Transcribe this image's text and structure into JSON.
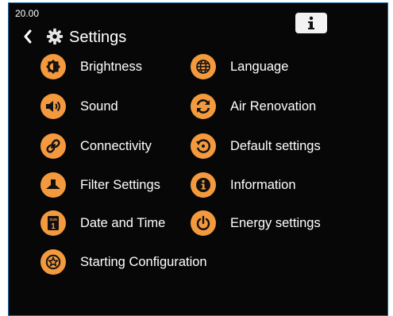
{
  "status": {
    "time": "20.00"
  },
  "header": {
    "title": "Settings",
    "back_icon": "chevron-left-icon",
    "title_icon": "gear-icon",
    "info_icon": "info-icon"
  },
  "colors": {
    "background": "#070707",
    "accent": "#f39a3e",
    "text": "#ffffff",
    "border": "#1a6fa8"
  },
  "menu": {
    "left": [
      {
        "label": "Brightness",
        "icon": "brightness-icon"
      },
      {
        "label": "Sound",
        "icon": "speaker-icon"
      },
      {
        "label": "Connectivity",
        "icon": "link-icon"
      },
      {
        "label": "Filter Settings",
        "icon": "hood-icon"
      },
      {
        "label": "Date and Time",
        "icon": "calendar-icon",
        "icon_text_top": "SUN",
        "icon_text_bottom": "1"
      },
      {
        "label": "Starting Configuration",
        "icon": "star-icon"
      }
    ],
    "right": [
      {
        "label": "Language",
        "icon": "globe-icon"
      },
      {
        "label": "Air Renovation",
        "icon": "refresh-icon"
      },
      {
        "label": "Default settings",
        "icon": "restore-icon"
      },
      {
        "label": "Information",
        "icon": "info-icon"
      },
      {
        "label": "Energy settings",
        "icon": "power-icon"
      }
    ]
  }
}
